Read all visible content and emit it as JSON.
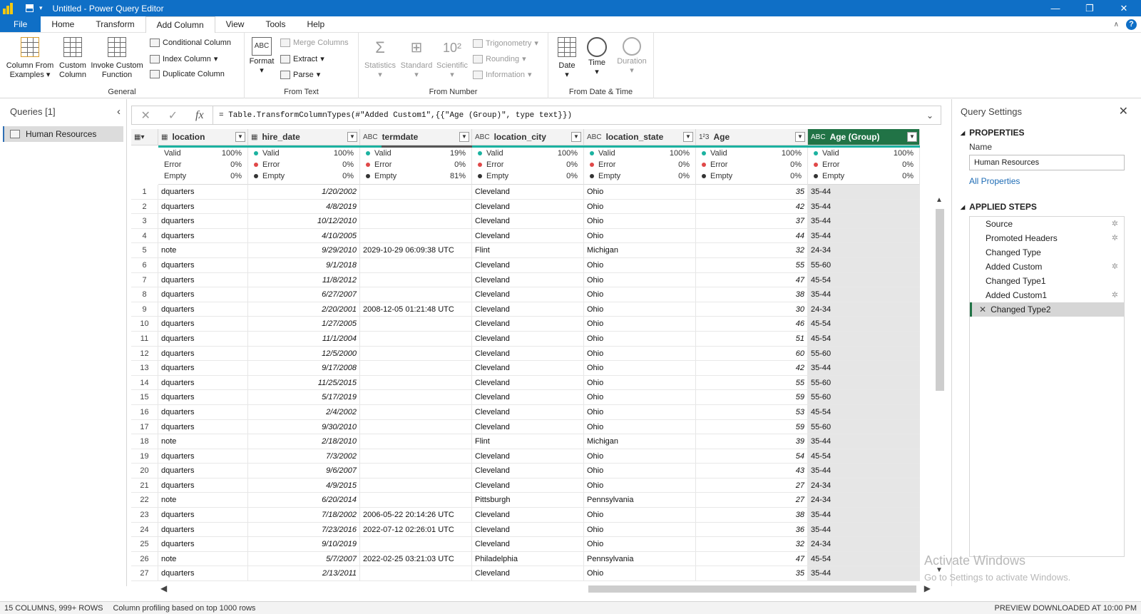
{
  "window": {
    "title": "Untitled - Power Query Editor"
  },
  "tabs": [
    "File",
    "Home",
    "Transform",
    "Add Column",
    "View",
    "Tools",
    "Help"
  ],
  "active_tab": "Add Column",
  "ribbon": {
    "general": {
      "label": "General",
      "column_from_examples_1": "Column From",
      "column_from_examples_2": "Examples",
      "custom_column_1": "Custom",
      "custom_column_2": "Column",
      "invoke_custom_function_1": "Invoke Custom",
      "invoke_custom_function_2": "Function",
      "conditional_column": "Conditional Column",
      "index_column": "Index Column",
      "duplicate_column": "Duplicate Column"
    },
    "from_text": {
      "label": "From Text",
      "format": "Format",
      "merge_columns": "Merge Columns",
      "extract": "Extract",
      "parse": "Parse"
    },
    "from_number": {
      "label": "From Number",
      "statistics": "Statistics",
      "standard": "Standard",
      "scientific": "Scientific",
      "trigonometry": "Trigonometry",
      "rounding": "Rounding",
      "information": "Information"
    },
    "from_date_time": {
      "label": "From Date & Time",
      "date": "Date",
      "time": "Time",
      "duration": "Duration"
    }
  },
  "queries": {
    "header": "Queries [1]",
    "items": [
      "Human Resources"
    ]
  },
  "formula": "= Table.TransformColumnTypes(#\"Added Custom1\",{{\"Age (Group)\", type text}})",
  "columns": [
    {
      "name": "location",
      "type": "tbl",
      "valid": "100%",
      "error": "0%",
      "empty": "0%"
    },
    {
      "name": "hire_date",
      "type": "cal",
      "valid": "100%",
      "error": "0%",
      "empty": "0%"
    },
    {
      "name": "termdate",
      "type": "ABC",
      "valid": "19%",
      "error": "0%",
      "empty": "81%"
    },
    {
      "name": "location_city",
      "type": "ABC",
      "valid": "100%",
      "error": "0%",
      "empty": "0%"
    },
    {
      "name": "location_state",
      "type": "ABC",
      "valid": "100%",
      "error": "0%",
      "empty": "0%"
    },
    {
      "name": "Age",
      "type": "123",
      "valid": "100%",
      "error": "0%",
      "empty": "0%"
    },
    {
      "name": "Age (Group)",
      "type": "ABC",
      "valid": "100%",
      "error": "0%",
      "empty": "0%"
    }
  ],
  "profile_labels": {
    "valid": "Valid",
    "error": "Error",
    "empty": "Empty"
  },
  "rows": [
    [
      "1",
      "dquarters",
      "1/20/2002",
      "",
      "Cleveland",
      "Ohio",
      "35",
      "35-44"
    ],
    [
      "2",
      "dquarters",
      "4/8/2019",
      "",
      "Cleveland",
      "Ohio",
      "42",
      "35-44"
    ],
    [
      "3",
      "dquarters",
      "10/12/2010",
      "",
      "Cleveland",
      "Ohio",
      "37",
      "35-44"
    ],
    [
      "4",
      "dquarters",
      "4/10/2005",
      "",
      "Cleveland",
      "Ohio",
      "44",
      "35-44"
    ],
    [
      "5",
      "note",
      "9/29/2010",
      "2029-10-29 06:09:38 UTC",
      "Flint",
      "Michigan",
      "32",
      "24-34"
    ],
    [
      "6",
      "dquarters",
      "9/1/2018",
      "",
      "Cleveland",
      "Ohio",
      "55",
      "55-60"
    ],
    [
      "7",
      "dquarters",
      "11/8/2012",
      "",
      "Cleveland",
      "Ohio",
      "47",
      "45-54"
    ],
    [
      "8",
      "dquarters",
      "6/27/2007",
      "",
      "Cleveland",
      "Ohio",
      "38",
      "35-44"
    ],
    [
      "9",
      "dquarters",
      "2/20/2001",
      "2008-12-05 01:21:48 UTC",
      "Cleveland",
      "Ohio",
      "30",
      "24-34"
    ],
    [
      "10",
      "dquarters",
      "1/27/2005",
      "",
      "Cleveland",
      "Ohio",
      "46",
      "45-54"
    ],
    [
      "11",
      "dquarters",
      "11/1/2004",
      "",
      "Cleveland",
      "Ohio",
      "51",
      "45-54"
    ],
    [
      "12",
      "dquarters",
      "12/5/2000",
      "",
      "Cleveland",
      "Ohio",
      "60",
      "55-60"
    ],
    [
      "13",
      "dquarters",
      "9/17/2008",
      "",
      "Cleveland",
      "Ohio",
      "42",
      "35-44"
    ],
    [
      "14",
      "dquarters",
      "11/25/2015",
      "",
      "Cleveland",
      "Ohio",
      "55",
      "55-60"
    ],
    [
      "15",
      "dquarters",
      "5/17/2019",
      "",
      "Cleveland",
      "Ohio",
      "59",
      "55-60"
    ],
    [
      "16",
      "dquarters",
      "2/4/2002",
      "",
      "Cleveland",
      "Ohio",
      "53",
      "45-54"
    ],
    [
      "17",
      "dquarters",
      "9/30/2010",
      "",
      "Cleveland",
      "Ohio",
      "59",
      "55-60"
    ],
    [
      "18",
      "note",
      "2/18/2010",
      "",
      "Flint",
      "Michigan",
      "39",
      "35-44"
    ],
    [
      "19",
      "dquarters",
      "7/3/2002",
      "",
      "Cleveland",
      "Ohio",
      "54",
      "45-54"
    ],
    [
      "20",
      "dquarters",
      "9/6/2007",
      "",
      "Cleveland",
      "Ohio",
      "43",
      "35-44"
    ],
    [
      "21",
      "dquarters",
      "4/9/2015",
      "",
      "Cleveland",
      "Ohio",
      "27",
      "24-34"
    ],
    [
      "22",
      "note",
      "6/20/2014",
      "",
      "Pittsburgh",
      "Pennsylvania",
      "27",
      "24-34"
    ],
    [
      "23",
      "dquarters",
      "7/18/2002",
      "2006-05-22 20:14:26 UTC",
      "Cleveland",
      "Ohio",
      "38",
      "35-44"
    ],
    [
      "24",
      "dquarters",
      "7/23/2016",
      "2022-07-12 02:26:01 UTC",
      "Cleveland",
      "Ohio",
      "36",
      "35-44"
    ],
    [
      "25",
      "dquarters",
      "9/10/2019",
      "",
      "Cleveland",
      "Ohio",
      "32",
      "24-34"
    ],
    [
      "26",
      "note",
      "5/7/2007",
      "2022-02-25 03:21:03 UTC",
      "Philadelphia",
      "Pennsylvania",
      "47",
      "45-54"
    ],
    [
      "27",
      "dquarters",
      "2/13/2011",
      "",
      "Cleveland",
      "Ohio",
      "35",
      "35-44"
    ]
  ],
  "settings": {
    "header": "Query Settings",
    "properties": "PROPERTIES",
    "name_label": "Name",
    "name_value": "Human Resources",
    "all_properties": "All Properties",
    "applied_steps": "APPLIED STEPS",
    "steps": [
      {
        "name": "Source",
        "gear": true
      },
      {
        "name": "Promoted Headers",
        "gear": true
      },
      {
        "name": "Changed Type",
        "gear": false
      },
      {
        "name": "Added Custom",
        "gear": true
      },
      {
        "name": "Changed Type1",
        "gear": false
      },
      {
        "name": "Added Custom1",
        "gear": true
      },
      {
        "name": "Changed Type2",
        "gear": false,
        "selected": true
      }
    ]
  },
  "status": {
    "columns_rows": "15 COLUMNS, 999+ ROWS",
    "profiling": "Column profiling based on top 1000 rows",
    "preview": "PREVIEW DOWNLOADED AT 10:00 PM"
  },
  "watermark": {
    "line1": "Activate Windows",
    "line2": "Go to Settings to activate Windows."
  },
  "colors": {
    "accent": "#0f6fc6",
    "selected_column": "#217346",
    "valid": "#1bb2a0",
    "error": "#e04848"
  }
}
